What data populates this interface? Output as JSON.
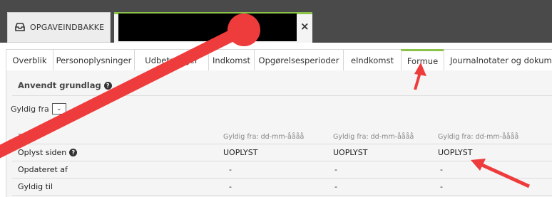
{
  "top_tabs": {
    "inbox_label": "OPGAVEINDBAKKE",
    "close_symbol": "×"
  },
  "sub_tabs": [
    {
      "label": "Overblik"
    },
    {
      "label": "Personoplysninger"
    },
    {
      "label": "Udbetalinger"
    },
    {
      "label": "Indkomst"
    },
    {
      "label": "Opgørelsesperioder"
    },
    {
      "label": "eIndkomst"
    },
    {
      "label": "Formue"
    },
    {
      "label": "Journalnotater og dokumenter"
    }
  ],
  "active_tab": "Formue",
  "section": {
    "title": "Anvendt grundlag",
    "gyldig_label": "Gyldig fra",
    "gyldig_value": "⌄"
  },
  "table": {
    "headers": [
      "Type",
      "Gyldig fra: dd-mm-åååå",
      "Gyldig fra: dd-mm-åååå",
      "Gyldig fra: dd-mm-åååå"
    ],
    "rows": [
      {
        "type": "Oplyst siden",
        "v1": "UOPLYST",
        "v2": "UOPLYST",
        "v3": "UOPLYST"
      },
      {
        "type": "Opdateret af",
        "v1": "-",
        "v2": "-",
        "v3": "-"
      },
      {
        "type": "Gyldig til",
        "v1": "-",
        "v2": "-",
        "v3": "-"
      }
    ]
  },
  "colors": {
    "accent_green": "#8bc34a",
    "annotation_red": "#ee3b3b"
  }
}
